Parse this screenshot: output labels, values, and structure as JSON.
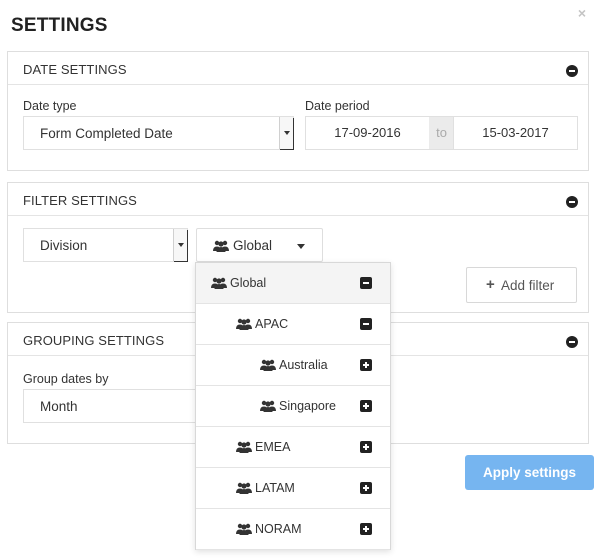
{
  "dialog": {
    "title": "SETTINGS",
    "close_glyph": "×"
  },
  "date_settings": {
    "title": "DATE SETTINGS",
    "date_type_label": "Date type",
    "date_type_value": "Form Completed Date",
    "date_period_label": "Date period",
    "date_from": "17-09-2016",
    "date_to_label": "to",
    "date_to": "15-03-2017"
  },
  "filter_settings": {
    "title": "FILTER SETTINGS",
    "filter_field": "Division",
    "filter_value": "Global",
    "add_filter_label": "Add filter",
    "add_filter_glyph": "+"
  },
  "grouping_settings": {
    "title": "GROUPING SETTINGS",
    "group_by_label": "Group dates by",
    "group_by_value": "Month"
  },
  "apply_label": "Apply settings",
  "dropdown": {
    "items": [
      {
        "label": "Global",
        "level": 0,
        "expanded": true
      },
      {
        "label": "APAC",
        "level": 1,
        "expanded": true
      },
      {
        "label": "Australia",
        "level": 2,
        "expanded": false
      },
      {
        "label": "Singapore",
        "level": 2,
        "expanded": false
      },
      {
        "label": "EMEA",
        "level": 1,
        "expanded": false
      },
      {
        "label": "LATAM",
        "level": 1,
        "expanded": false
      },
      {
        "label": "NORAM",
        "level": 1,
        "expanded": false
      }
    ]
  },
  "icons": {
    "group": "users-icon",
    "collapse": "minus-circle-icon",
    "expand": "plus-square-icon",
    "collapse_node": "minus-square-icon"
  },
  "colors": {
    "accent": "#76b5f0",
    "border": "#dedede",
    "text": "#333333"
  }
}
